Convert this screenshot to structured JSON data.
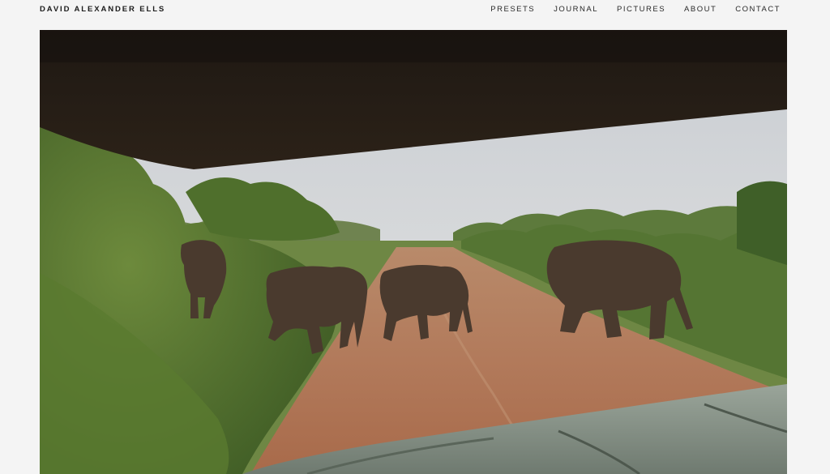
{
  "site": {
    "brand": "DAVID ALEXANDER ELLS"
  },
  "nav": {
    "items": [
      {
        "label": "PRESETS"
      },
      {
        "label": "JOURNAL"
      },
      {
        "label": "PICTURES"
      },
      {
        "label": "ABOUT"
      },
      {
        "label": "CONTACT"
      }
    ]
  },
  "colors": {
    "page_background": "#f4f4f4",
    "text": "#1c1c1c"
  }
}
